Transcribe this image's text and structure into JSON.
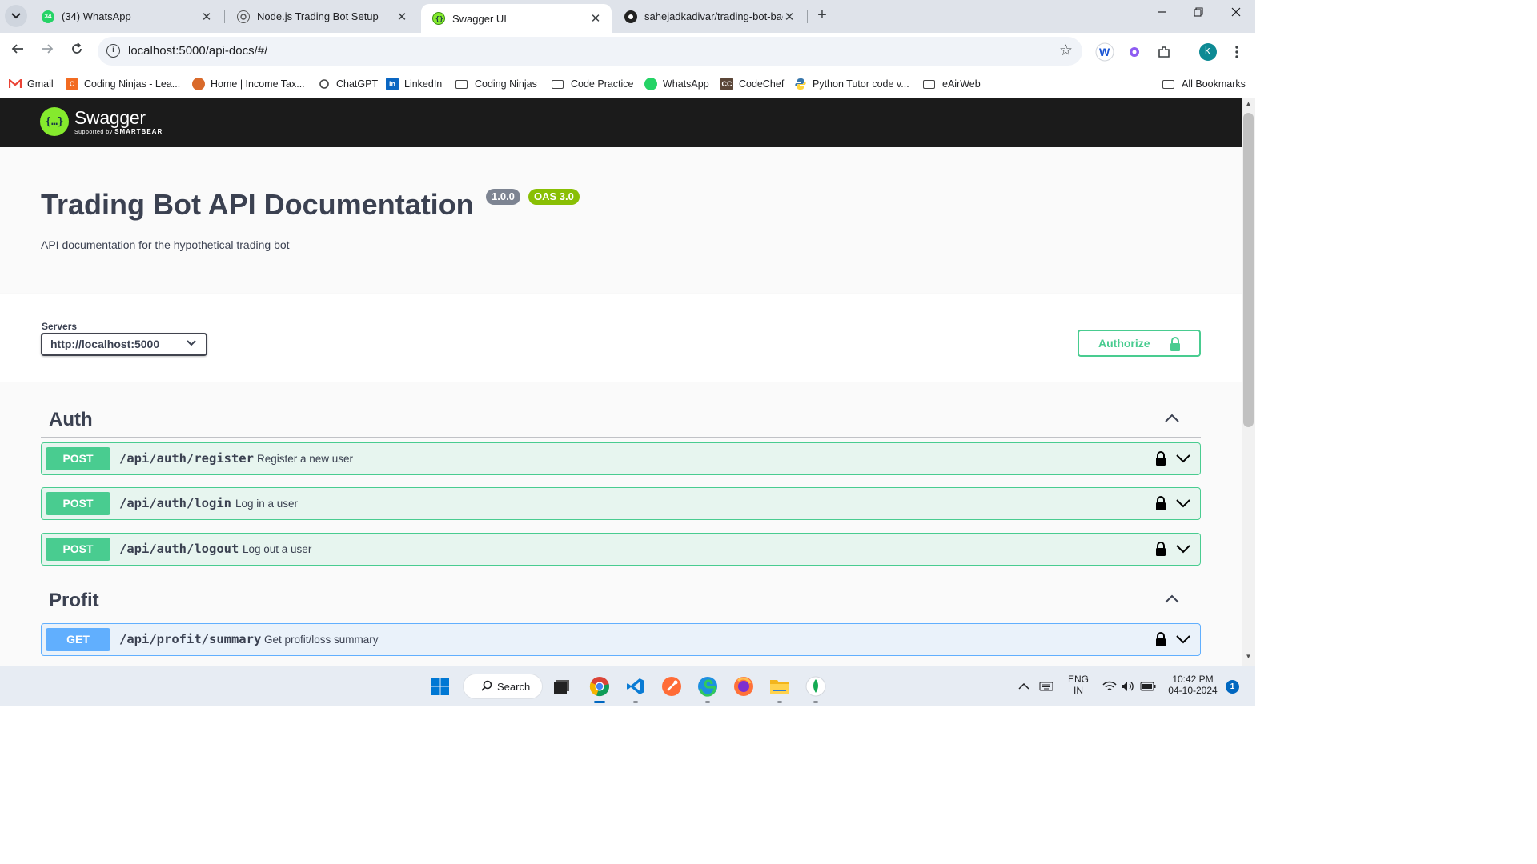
{
  "browser": {
    "tabs": [
      {
        "title": "(34) WhatsApp",
        "favicon": "whatsapp-icon",
        "badge": "34"
      },
      {
        "title": "Node.js Trading Bot Setup",
        "favicon": "chatgpt-icon"
      },
      {
        "title": "Swagger UI",
        "favicon": "swagger-icon"
      },
      {
        "title": "sahejadkadivar/trading-bot-bac",
        "favicon": "github-icon"
      }
    ],
    "active_tab_index": 2,
    "url": "localhost:5000/api-docs/#/",
    "profile_initial": "k",
    "bookmarks": [
      {
        "label": "Gmail",
        "icon": "gmail-icon"
      },
      {
        "label": "Coding Ninjas - Lea...",
        "icon": "coding-ninjas-icon"
      },
      {
        "label": "Home | Income Tax...",
        "icon": "income-tax-icon"
      },
      {
        "label": "ChatGPT",
        "icon": "chatgpt-icon"
      },
      {
        "label": "LinkedIn",
        "icon": "linkedin-icon"
      },
      {
        "label": "Coding Ninjas",
        "icon": "folder-icon"
      },
      {
        "label": "Code Practice",
        "icon": "folder-icon"
      },
      {
        "label": "WhatsApp",
        "icon": "whatsapp-icon"
      },
      {
        "label": "CodeChef",
        "icon": "codechef-icon"
      },
      {
        "label": "Python Tutor code v...",
        "icon": "python-icon"
      },
      {
        "label": "eAirWeb",
        "icon": "folder-icon"
      }
    ],
    "all_bookmarks_label": "All Bookmarks"
  },
  "swagger": {
    "logo_name": "Swagger",
    "logo_supported_by": "Supported by",
    "logo_company": "SMARTBEAR",
    "title": "Trading Bot API Documentation",
    "version_badge": "1.0.0",
    "oas_badge": "OAS 3.0",
    "description": "API documentation for the hypothetical trading bot",
    "servers_label": "Servers",
    "server_selected": "http://localhost:5000",
    "authorize_label": "Authorize",
    "tags": [
      {
        "name": "Auth",
        "operations": [
          {
            "method": "POST",
            "path": "/api/auth/register",
            "summary": "Register a new user"
          },
          {
            "method": "POST",
            "path": "/api/auth/login",
            "summary": "Log in a user"
          },
          {
            "method": "POST",
            "path": "/api/auth/logout",
            "summary": "Log out a user"
          }
        ]
      },
      {
        "name": "Profit",
        "operations": [
          {
            "method": "GET",
            "path": "/api/profit/summary",
            "summary": "Get profit/loss summary"
          }
        ]
      }
    ],
    "colors": {
      "post": "#49cc90",
      "get": "#61affe",
      "topbar": "#1b1b1b",
      "logo": "#85ea2d"
    }
  },
  "taskbar": {
    "search_label": "Search",
    "language": "ENG",
    "region": "IN",
    "time": "10:42 PM",
    "date": "04-10-2024",
    "notification_count": "1",
    "pinned": [
      "windows-start-icon",
      "task-view-icon",
      "chrome-icon",
      "vscode-icon",
      "postman-icon",
      "edge-icon",
      "firefox-icon",
      "file-explorer-icon",
      "mongodb-compass-icon"
    ]
  }
}
